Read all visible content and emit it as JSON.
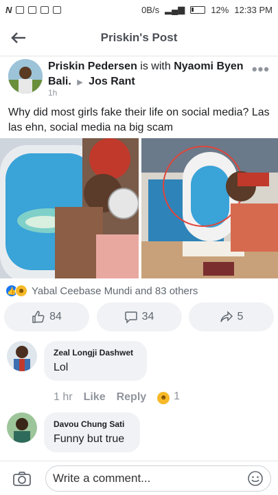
{
  "status_bar": {
    "left_icons": "N",
    "speed": "0B/s",
    "battery": "12%",
    "time": "12:33 PM"
  },
  "header": {
    "title": "Priskin's Post"
  },
  "post": {
    "author": "Priskin Pedersen",
    "with_text": "is with",
    "tagged1": "Nyaomi Byen Bali.",
    "tagged2": "Jos Rant",
    "time": "1h",
    "text": "Why did most girls fake their life on social media?  Las las ehn, social media na big scam"
  },
  "reactions": {
    "summary": "Yabal Ceebase Mundi and 83 others"
  },
  "actions": {
    "like_count": "84",
    "comment_count": "34",
    "share_count": "5"
  },
  "comments": [
    {
      "name": "Zeal Longji Dashwet",
      "text": "Lol",
      "time": "1 hr",
      "like": "Like",
      "reply": "Reply",
      "reaction_count": "1"
    },
    {
      "name": "Davou Chung Sati",
      "text": "Funny but true"
    }
  ],
  "composer": {
    "placeholder": "Write a comment..."
  },
  "colors": {
    "accent": "#1877f2",
    "bubble": "#f0f2f5",
    "muted": "#90949c"
  }
}
